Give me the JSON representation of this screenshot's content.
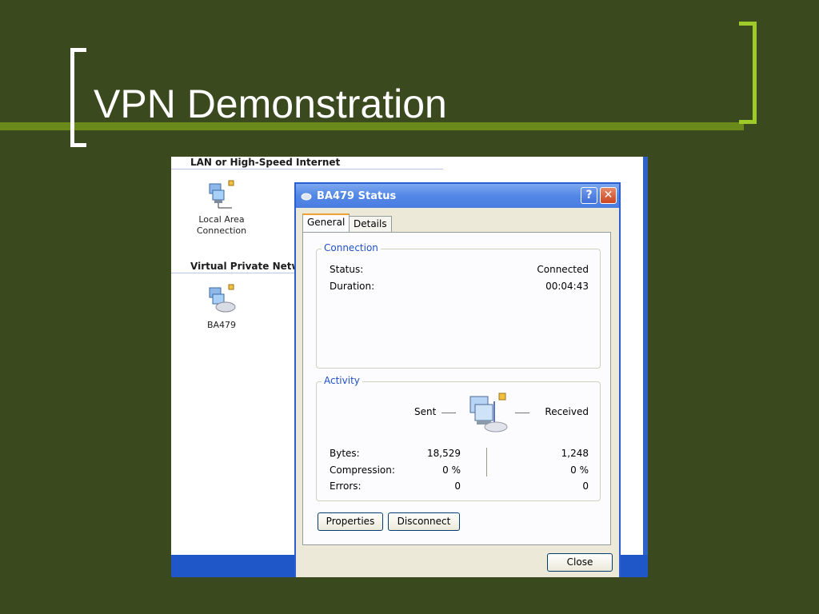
{
  "slide": {
    "title": "VPN Demonstration"
  },
  "network_connections": {
    "lan_header": "LAN or High-Speed Internet",
    "vpn_header": "Virtual Private Netwo",
    "items": [
      {
        "label_line1": "Local Area",
        "label_line2": "Connection",
        "icon": "network-computer-icon"
      },
      {
        "label_line1": "BA479",
        "label_line2": "",
        "icon": "vpn-connection-icon"
      }
    ]
  },
  "dialog": {
    "title": "BA479 Status",
    "help_glyph": "?",
    "close_glyph": "✕",
    "tabs": [
      "General",
      "Details"
    ],
    "connection": {
      "label": "Connection",
      "status_label": "Status:",
      "status_value": "Connected",
      "duration_label": "Duration:",
      "duration_value": "00:04:43"
    },
    "activity": {
      "label": "Activity",
      "sent_label": "Sent",
      "received_label": "Received",
      "rows": [
        {
          "label": "Bytes:",
          "sent": "18,529",
          "received": "1,248"
        },
        {
          "label": "Compression:",
          "sent": "0 %",
          "received": "0 %"
        },
        {
          "label": "Errors:",
          "sent": "0",
          "received": "0"
        }
      ]
    },
    "buttons": {
      "properties": "Properties",
      "disconnect": "Disconnect",
      "close": "Close"
    }
  },
  "colors": {
    "slide_background": "#3a4a1e",
    "accent_green": "#9ecb2a",
    "xp_titlebar_blue": "#4a7de0",
    "group_label_blue": "#1f50c8"
  }
}
